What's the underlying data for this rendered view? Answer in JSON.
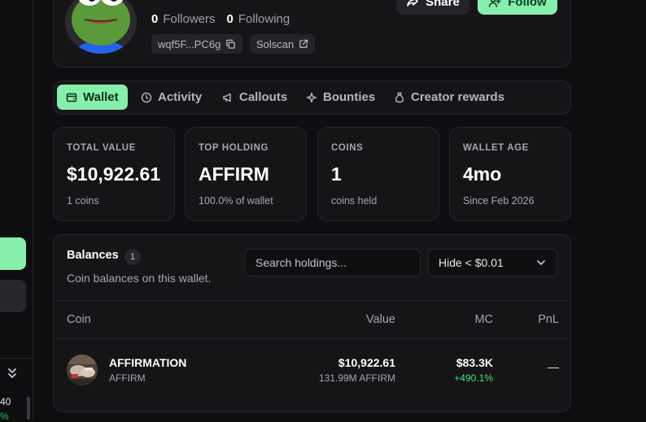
{
  "profile": {
    "followers_count": "0",
    "followers_label": "Followers",
    "following_count": "0",
    "following_label": "Following",
    "wallet_short": "wqf5F...PC6g",
    "solscan_label": "Solscan",
    "share_label": "Share",
    "follow_label": "Follow"
  },
  "tabs": [
    {
      "label": "Wallet",
      "icon": "wallet-icon",
      "active": true
    },
    {
      "label": "Activity",
      "icon": "clock-icon",
      "active": false
    },
    {
      "label": "Callouts",
      "icon": "megaphone-icon",
      "active": false
    },
    {
      "label": "Bounties",
      "icon": "sparkle-icon",
      "active": false
    },
    {
      "label": "Creator rewards",
      "icon": "money-bag-icon",
      "active": false
    }
  ],
  "stats": [
    {
      "label": "TOTAL VALUE",
      "value": "$10,922.61",
      "sub": "1 coins"
    },
    {
      "label": "TOP HOLDING",
      "value": "AFFIRM",
      "sub": "100.0% of wallet"
    },
    {
      "label": "COINS",
      "value": "1",
      "sub": "coins held"
    },
    {
      "label": "WALLET AGE",
      "value": "4mo",
      "sub": "Since Feb 2026"
    }
  ],
  "balances": {
    "title": "Balances",
    "count": "1",
    "subtitle": "Coin balances on this wallet.",
    "search_placeholder": "Search holdings...",
    "filter_value": "Hide < $0.01",
    "columns": {
      "coin": "Coin",
      "value": "Value",
      "mc": "MC",
      "pnl": "PnL"
    },
    "rows": [
      {
        "name": "AFFIRMATION",
        "ticker": "AFFIRM",
        "value": "$10,922.61",
        "amount": "131.99M AFFIRM",
        "mc": "$83.3K",
        "mc_change": "+490.1%",
        "pnl": "—"
      }
    ]
  },
  "sidebar": {
    "partial_number": "40",
    "partial_pct": "%"
  },
  "colors": {
    "accent": "#86efac",
    "positive": "#4ade80",
    "background": "#0e0e10",
    "card": "#151518"
  }
}
